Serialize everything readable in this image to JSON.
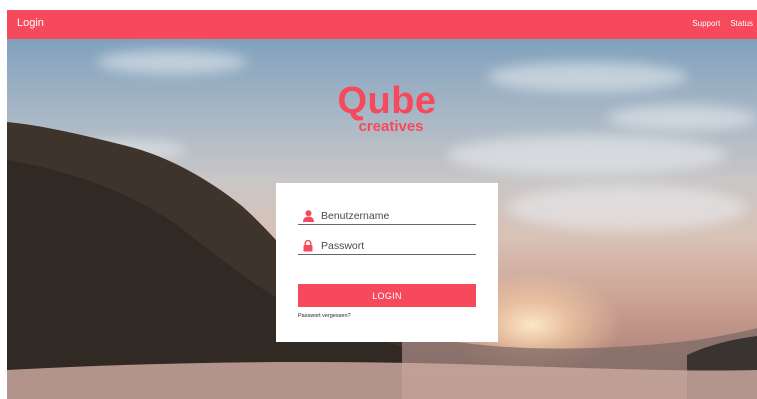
{
  "header": {
    "title": "Login",
    "links": [
      "Support",
      "Status"
    ]
  },
  "brand": {
    "logo_main": "Qube",
    "logo_sub": "creatives"
  },
  "login_form": {
    "username_placeholder": "Benutzername",
    "password_placeholder": "Passwort",
    "submit_label": "LOGIN",
    "forgot_password_label": "Passwort vergessen?"
  },
  "icons": {
    "username": "user-icon",
    "password": "lock-icon"
  },
  "colors": {
    "accent": "#f64a5c",
    "card_background": "#ffffff"
  }
}
